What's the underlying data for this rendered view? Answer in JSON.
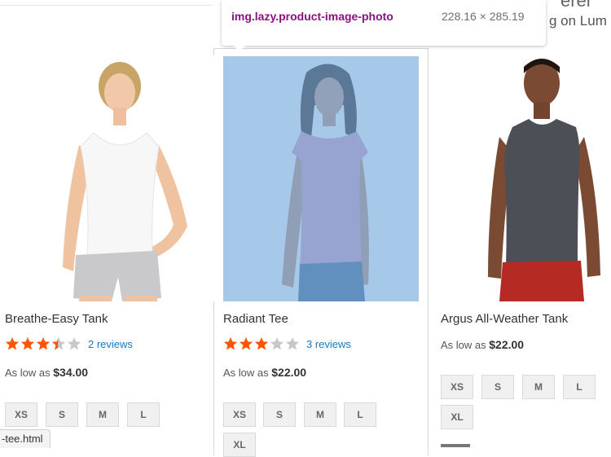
{
  "devtools_tooltip": {
    "selector": "img.lazy.product-image-photo",
    "dimensions": "228.16 × 285.19"
  },
  "background_text": {
    "line1": "g on Lum",
    "line0": "erer"
  },
  "products": [
    {
      "name": "Breathe-Easy Tank",
      "rating_fraction": 0.7,
      "reviews": "2 reviews",
      "price_prefix": "As low as",
      "price": "$34.00",
      "sizes": [
        "XS",
        "S",
        "M",
        "L"
      ]
    },
    {
      "name": "Radiant Tee",
      "rating_fraction": 0.6,
      "reviews": "3 reviews",
      "price_prefix": "As low as",
      "price": "$22.00",
      "sizes": [
        "XS",
        "S",
        "M",
        "L",
        "XL"
      ]
    },
    {
      "name": "Argus All-Weather Tank",
      "price_prefix": "As low as",
      "price": "$22.00",
      "sizes": [
        "XS",
        "S",
        "M",
        "L",
        "XL"
      ]
    }
  ],
  "status_bar": {
    "url": "-tee.html"
  },
  "colors": {
    "star": "#ff5501",
    "star_empty": "#c7c7c7",
    "highlight_overlay": "#6fa8dc",
    "link": "#1979c3",
    "selector_text": "#881280"
  }
}
